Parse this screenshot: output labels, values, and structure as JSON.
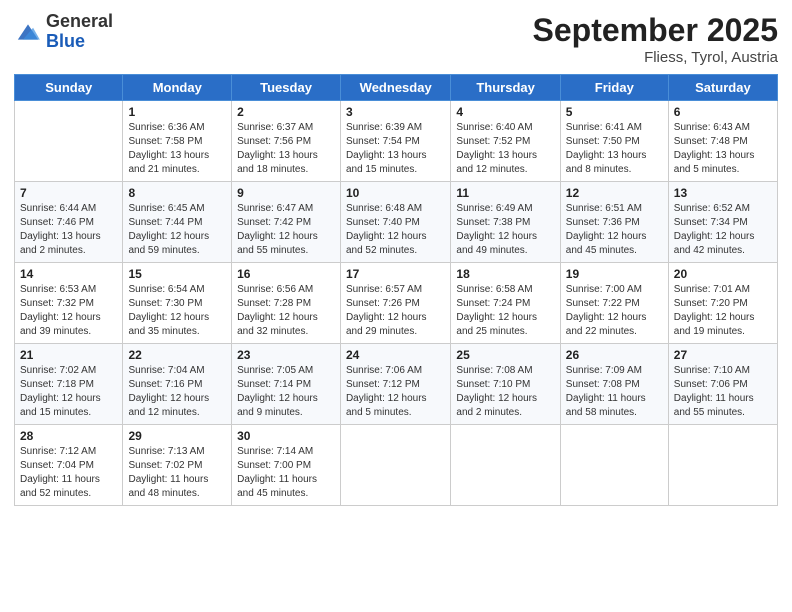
{
  "header": {
    "logo_general": "General",
    "logo_blue": "Blue",
    "month_title": "September 2025",
    "location": "Fliess, Tyrol, Austria"
  },
  "weekdays": [
    "Sunday",
    "Monday",
    "Tuesday",
    "Wednesday",
    "Thursday",
    "Friday",
    "Saturday"
  ],
  "weeks": [
    [
      {
        "num": "",
        "info": ""
      },
      {
        "num": "1",
        "info": "Sunrise: 6:36 AM\nSunset: 7:58 PM\nDaylight: 13 hours\nand 21 minutes."
      },
      {
        "num": "2",
        "info": "Sunrise: 6:37 AM\nSunset: 7:56 PM\nDaylight: 13 hours\nand 18 minutes."
      },
      {
        "num": "3",
        "info": "Sunrise: 6:39 AM\nSunset: 7:54 PM\nDaylight: 13 hours\nand 15 minutes."
      },
      {
        "num": "4",
        "info": "Sunrise: 6:40 AM\nSunset: 7:52 PM\nDaylight: 13 hours\nand 12 minutes."
      },
      {
        "num": "5",
        "info": "Sunrise: 6:41 AM\nSunset: 7:50 PM\nDaylight: 13 hours\nand 8 minutes."
      },
      {
        "num": "6",
        "info": "Sunrise: 6:43 AM\nSunset: 7:48 PM\nDaylight: 13 hours\nand 5 minutes."
      }
    ],
    [
      {
        "num": "7",
        "info": "Sunrise: 6:44 AM\nSunset: 7:46 PM\nDaylight: 13 hours\nand 2 minutes."
      },
      {
        "num": "8",
        "info": "Sunrise: 6:45 AM\nSunset: 7:44 PM\nDaylight: 12 hours\nand 59 minutes."
      },
      {
        "num": "9",
        "info": "Sunrise: 6:47 AM\nSunset: 7:42 PM\nDaylight: 12 hours\nand 55 minutes."
      },
      {
        "num": "10",
        "info": "Sunrise: 6:48 AM\nSunset: 7:40 PM\nDaylight: 12 hours\nand 52 minutes."
      },
      {
        "num": "11",
        "info": "Sunrise: 6:49 AM\nSunset: 7:38 PM\nDaylight: 12 hours\nand 49 minutes."
      },
      {
        "num": "12",
        "info": "Sunrise: 6:51 AM\nSunset: 7:36 PM\nDaylight: 12 hours\nand 45 minutes."
      },
      {
        "num": "13",
        "info": "Sunrise: 6:52 AM\nSunset: 7:34 PM\nDaylight: 12 hours\nand 42 minutes."
      }
    ],
    [
      {
        "num": "14",
        "info": "Sunrise: 6:53 AM\nSunset: 7:32 PM\nDaylight: 12 hours\nand 39 minutes."
      },
      {
        "num": "15",
        "info": "Sunrise: 6:54 AM\nSunset: 7:30 PM\nDaylight: 12 hours\nand 35 minutes."
      },
      {
        "num": "16",
        "info": "Sunrise: 6:56 AM\nSunset: 7:28 PM\nDaylight: 12 hours\nand 32 minutes."
      },
      {
        "num": "17",
        "info": "Sunrise: 6:57 AM\nSunset: 7:26 PM\nDaylight: 12 hours\nand 29 minutes."
      },
      {
        "num": "18",
        "info": "Sunrise: 6:58 AM\nSunset: 7:24 PM\nDaylight: 12 hours\nand 25 minutes."
      },
      {
        "num": "19",
        "info": "Sunrise: 7:00 AM\nSunset: 7:22 PM\nDaylight: 12 hours\nand 22 minutes."
      },
      {
        "num": "20",
        "info": "Sunrise: 7:01 AM\nSunset: 7:20 PM\nDaylight: 12 hours\nand 19 minutes."
      }
    ],
    [
      {
        "num": "21",
        "info": "Sunrise: 7:02 AM\nSunset: 7:18 PM\nDaylight: 12 hours\nand 15 minutes."
      },
      {
        "num": "22",
        "info": "Sunrise: 7:04 AM\nSunset: 7:16 PM\nDaylight: 12 hours\nand 12 minutes."
      },
      {
        "num": "23",
        "info": "Sunrise: 7:05 AM\nSunset: 7:14 PM\nDaylight: 12 hours\nand 9 minutes."
      },
      {
        "num": "24",
        "info": "Sunrise: 7:06 AM\nSunset: 7:12 PM\nDaylight: 12 hours\nand 5 minutes."
      },
      {
        "num": "25",
        "info": "Sunrise: 7:08 AM\nSunset: 7:10 PM\nDaylight: 12 hours\nand 2 minutes."
      },
      {
        "num": "26",
        "info": "Sunrise: 7:09 AM\nSunset: 7:08 PM\nDaylight: 11 hours\nand 58 minutes."
      },
      {
        "num": "27",
        "info": "Sunrise: 7:10 AM\nSunset: 7:06 PM\nDaylight: 11 hours\nand 55 minutes."
      }
    ],
    [
      {
        "num": "28",
        "info": "Sunrise: 7:12 AM\nSunset: 7:04 PM\nDaylight: 11 hours\nand 52 minutes."
      },
      {
        "num": "29",
        "info": "Sunrise: 7:13 AM\nSunset: 7:02 PM\nDaylight: 11 hours\nand 48 minutes."
      },
      {
        "num": "30",
        "info": "Sunrise: 7:14 AM\nSunset: 7:00 PM\nDaylight: 11 hours\nand 45 minutes."
      },
      {
        "num": "",
        "info": ""
      },
      {
        "num": "",
        "info": ""
      },
      {
        "num": "",
        "info": ""
      },
      {
        "num": "",
        "info": ""
      }
    ]
  ]
}
